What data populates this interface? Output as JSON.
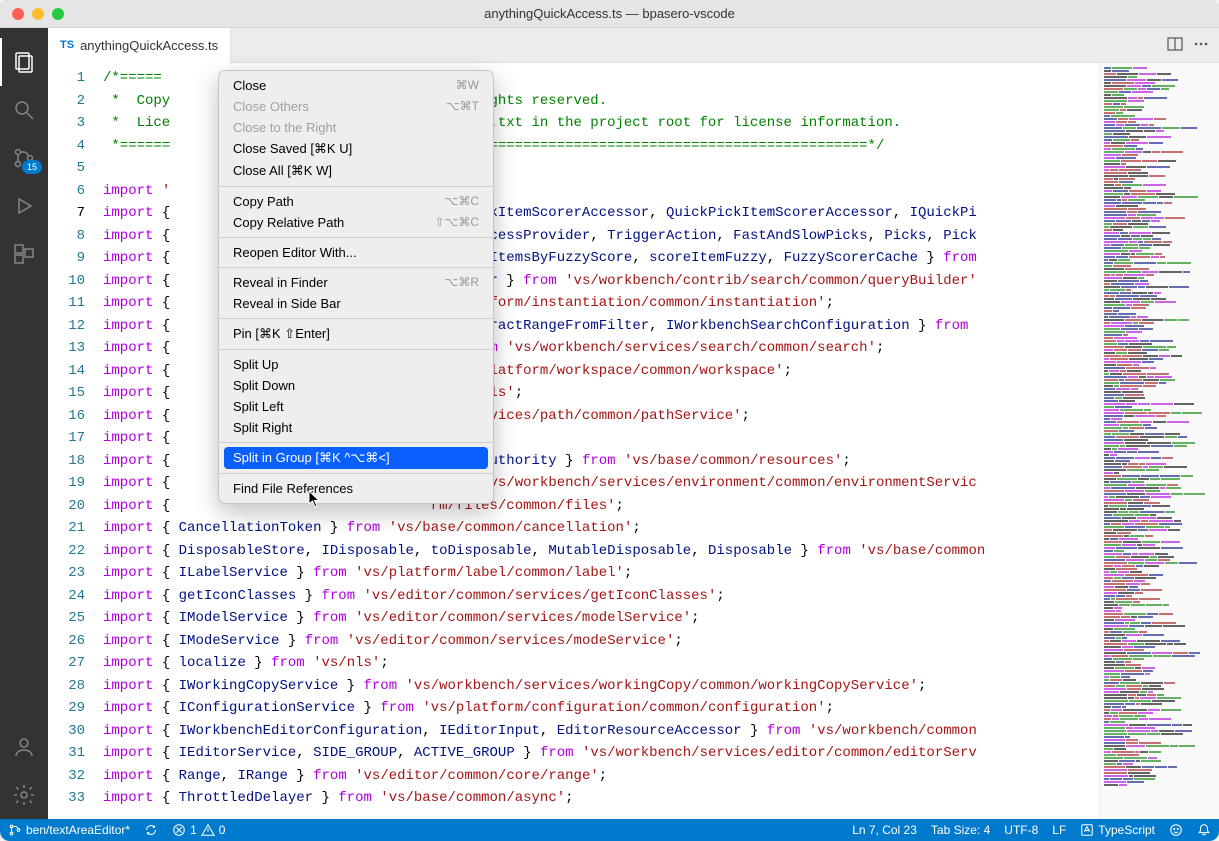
{
  "window_title": "anythingQuickAccess.ts — bpasero-vscode",
  "tab": {
    "file_icon": "TS",
    "filename": "anythingQuickAccess.ts"
  },
  "activitybar": {
    "scm_badge": "15"
  },
  "gutter": {
    "current_line": 7,
    "last_line": 33
  },
  "code_lines": [
    {
      "html": "<span class='tok-comment'>/*=====</span>"
    },
    {
      "html": "<span class='tok-comment'> *  Copy</span><span style='visibility:hidden'>xxxxxxxxxxxxxxxxxxxxxxxxxxxxxx</span><span class='tok-comment'>. All rights reserved.</span>"
    },
    {
      "html": "<span class='tok-comment'> *  Lice</span><span style='visibility:hidden'>xxxxxxxxxxxxxxxxxxxxxxxxxxxxxx</span><span class='tok-comment'> License.txt in the project root for license information.</span>"
    },
    {
      "html": "<span class='tok-comment'> *======</span><span style='visibility:hidden'>xxxxxxxxxxxxxxxxxxxxxxxxxxxxxx</span><span class='tok-comment'>=====================================================*/</span>"
    },
    {
      "html": ""
    },
    {
      "html": "<span class='tok-kw'>import</span> <span class='tok-str'>'</span><span style='visibility:hidden'>xxxxxxxxxxxxxxxxxxxxxxxxxxxxxx</span><span class='tok-str'>ess'</span>;"
    },
    {
      "html": "<span class='tok-kw'>import</span> { <span style='visibility:hidden'>xxxxxxxxxxxxxxxxxxxxxxxxxxxxxx</span><span class='tok-var'>uickPickItemScorerAccessor</span>, <span class='tok-var'>QuickPickItemScorerAccessor</span>, <span class='tok-var'>IQuickPi</span>"
    },
    {
      "html": "<span class='tok-kw'>import</span> { <span style='visibility:hidden'>xxxxxxxxxxxxxxxxxxxxxxxxxxxxxx</span><span class='tok-var'>QuickAccessProvider</span>, <span class='tok-var'>TriggerAction</span>, <span class='tok-var'>FastAndSlowPicks</span>, <span class='tok-var'>Picks</span>, <span class='tok-var'>Pick</span>"
    },
    {
      "html": "<span class='tok-kw'>import</span> { <span style='visibility:hidden'>xxxxxxxxxxxxxxxxxxxxxxxxxxxxxx</span><span class='tok-var'>compareItemsByFuzzyScore</span>, <span class='tok-var'>scoreItemFuzzy</span>, <span class='tok-var'>FuzzyScorerCache</span> } <span class='tok-kw'>from</span>"
    },
    {
      "html": "<span class='tok-kw'>import</span> { <span style='visibility:hidden'>xxxxxxxxxxxxxxxxxxxxxxxxxxxxxx</span><span class='tok-var'>yBuilder</span> } <span class='tok-kw'>from</span> <span class='tok-str'>'vs/workbench/contrib/search/common/queryBuilder'</span>"
    },
    {
      "html": "<span class='tok-kw'>import</span> { <span style='visibility:hidden'>xxxxxxxxxxxxxxxxxxxxxxxxxxxxxx</span><span class='tok-str'>vs/platform/instantiation/common/instantiation'</span>;"
    },
    {
      "html": "<span class='tok-kw'>import</span> { <span style='visibility:hidden'>xxxxxxxxxxxxxxxxxxxxxxxxxxxxxx</span><span class='tok-var'>es</span>, <span class='tok-var'>extractRangeFromFilter</span>, <span class='tok-var'>IWorkbenchSearchConfiguration</span> } <span class='tok-kw'>from</span>"
    },
    {
      "html": "<span class='tok-kw'>import</span> { <span style='visibility:hidden'>xxxxxxxxxxxxxxxxxxxxxxxxxxxxxx</span><span class='tok-var'>e</span> } <span class='tok-kw'>from</span> <span class='tok-str'>'vs/workbench/services/search/common/search'</span>;"
    },
    {
      "html": "<span class='tok-kw'>import</span> { <span style='visibility:hidden'>xxxxxxxxxxxxxxxxxxxxxxxxxxxxxx</span><span class='tok-var'>m</span> <span class='tok-str'>'vs/platform/workspace/common/workspace'</span>;"
    },
    {
      "html": "<span class='tok-kw'>import</span> { <span style='visibility:hidden'>xxxxxxxxxxxxxxxxxxxxxxxxxxxxxx</span><span class='tok-str'>on/labels'</span>;"
    },
    {
      "html": "<span class='tok-kw'>import</span> { <span style='visibility:hidden'>xxxxxxxxxxxxxxxxxxxxxxxxxxxxxx</span><span class='tok-str'>nch/services/path/common/pathService'</span>;"
    },
    {
      "html": "<span class='tok-kw'>import</span> { <span style='visibility:hidden'>xxxxxxxxxxxxxxxxxxxxxxxxxxxxxx</span><span class='tok-str'>'</span>;"
    },
    {
      "html": "<span class='tok-kw'>import</span> { <span style='visibility:hidden'>xxxxxxxxxxxxxxxxxxxxxxxxxxxxxx</span><span class='tok-var'>nameOrAuthority</span> } <span class='tok-kw'>from</span> <span class='tok-str'>'vs/base/common/resources'</span>;"
    },
    {
      "html": "<span class='tok-kw'>import</span> { <span style='visibility:hidden'>xxxxxxxxxxxxxxxxxxxxxxxxxxxxxx</span> <span class='tok-kw'>from</span> <span class='tok-str'>'vs/workbench/services/environment/common/environmentServic</span>"
    },
    {
      "html": "<span class='tok-kw'>import</span> { <span style='visibility:hidden'>xxxxxxxxxxxxxxxxxxxxxxxxxxxxxx</span><span class='tok-str'>rm/files/common/files'</span>;"
    },
    {
      "html": "<span class='tok-kw'>import</span> { <span class='tok-var'>CancellationToken</span> } <span class='tok-kw'>from</span> <span class='tok-str'>'vs/base/common/cancellation'</span>;"
    },
    {
      "html": "<span class='tok-kw'>import</span> { <span class='tok-var'>DisposableStore</span>, <span class='tok-var'>IDisposable</span>, <span class='tok-var'>toDisposable</span>, <span class='tok-var'>MutableDisposable</span>, <span class='tok-var'>Disposable</span> } <span class='tok-kw'>from</span> <span class='tok-str'>'vs/base/common</span>"
    },
    {
      "html": "<span class='tok-kw'>import</span> { <span class='tok-var'>ILabelService</span> } <span class='tok-kw'>from</span> <span class='tok-str'>'vs/platform/label/common/label'</span>;"
    },
    {
      "html": "<span class='tok-kw'>import</span> { <span class='tok-var'>getIconClasses</span> } <span class='tok-kw'>from</span> <span class='tok-str'>'vs/editor/common/services/getIconClasses'</span>;"
    },
    {
      "html": "<span class='tok-kw'>import</span> { <span class='tok-var'>IModelService</span> } <span class='tok-kw'>from</span> <span class='tok-str'>'vs/editor/common/services/modelService'</span>;"
    },
    {
      "html": "<span class='tok-kw'>import</span> { <span class='tok-var'>IModeService</span> } <span class='tok-kw'>from</span> <span class='tok-str'>'vs/editor/common/services/modeService'</span>;"
    },
    {
      "html": "<span class='tok-kw'>import</span> { <span class='tok-var'>localize</span> } <span class='tok-kw'>from</span> <span class='tok-str'>'vs/nls'</span>;"
    },
    {
      "html": "<span class='tok-kw'>import</span> { <span class='tok-var'>IWorkingCopyService</span> } <span class='tok-kw'>from</span> <span class='tok-str'>'vs/workbench/services/workingCopy/common/workingCopyService'</span>;"
    },
    {
      "html": "<span class='tok-kw'>import</span> { <span class='tok-var'>IConfigurationService</span> } <span class='tok-kw'>from</span> <span class='tok-str'>'vs/platform/configuration/common/configuration'</span>;"
    },
    {
      "html": "<span class='tok-kw'>import</span> { <span class='tok-var'>IWorkbenchEditorConfiguration</span>, <span class='tok-var'>IEditorInput</span>, <span class='tok-var'>EditorResourceAccessor</span> } <span class='tok-kw'>from</span> <span class='tok-str'>'vs/workbench/common</span>"
    },
    {
      "html": "<span class='tok-kw'>import</span> { <span class='tok-var'>IEditorService</span>, <span class='tok-var'>SIDE_GROUP</span>, <span class='tok-var'>ACTIVE_GROUP</span> } <span class='tok-kw'>from</span> <span class='tok-str'>'vs/workbench/services/editor/common/editorServ</span>"
    },
    {
      "html": "<span class='tok-kw'>import</span> { <span class='tok-var'>Range</span>, <span class='tok-var'>IRange</span> } <span class='tok-kw'>from</span> <span class='tok-str'>'vs/editor/common/core/range'</span>;"
    },
    {
      "html": "<span class='tok-kw'>import</span> { <span class='tok-var'>ThrottledDelayer</span> } <span class='tok-kw'>from</span> <span class='tok-str'>'vs/base/common/async'</span>;"
    }
  ],
  "context_menu": {
    "groups": [
      [
        {
          "label": "Close",
          "shortcut": "⌘W"
        },
        {
          "label": "Close Others",
          "shortcut": "⌥⌘T",
          "disabled": true
        },
        {
          "label": "Close to the Right",
          "disabled": true
        },
        {
          "label": "Close Saved [⌘K U]"
        },
        {
          "label": "Close All [⌘K W]"
        }
      ],
      [
        {
          "label": "Copy Path",
          "shortcut": "⌥⌘C"
        },
        {
          "label": "Copy Relative Path",
          "shortcut": "⇧⌥⌘C"
        }
      ],
      [
        {
          "label": "Reopen Editor With..."
        }
      ],
      [
        {
          "label": "Reveal in Finder",
          "shortcut": "⌥⌘R"
        },
        {
          "label": "Reveal in Side Bar"
        }
      ],
      [
        {
          "label": "Pin [⌘K ⇧Enter]"
        }
      ],
      [
        {
          "label": "Split Up"
        },
        {
          "label": "Split Down"
        },
        {
          "label": "Split Left"
        },
        {
          "label": "Split Right"
        }
      ],
      [
        {
          "label": "Split in Group [⌘K ^⌥⌘<]",
          "highlight": true
        }
      ],
      [
        {
          "label": "Find File References"
        }
      ]
    ]
  },
  "statusbar": {
    "branch": "ben/textAreaEditor*",
    "errors": "1",
    "warnings": "0",
    "position": "Ln 7, Col 23",
    "tab_size": "Tab Size: 4",
    "encoding": "UTF-8",
    "eol": "LF",
    "language": "TypeScript"
  }
}
